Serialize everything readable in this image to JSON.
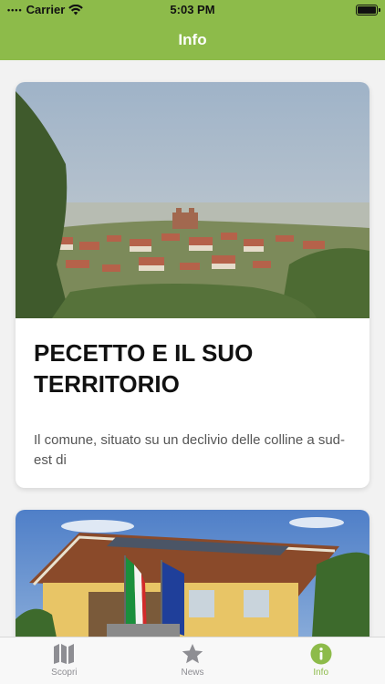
{
  "status_bar": {
    "carrier": "Carrier",
    "time": "5:03 PM"
  },
  "nav": {
    "title": "Info"
  },
  "cards": [
    {
      "title": "PECETTO E IL SUO TERRITORIO",
      "description": "Il comune, situato su un declivio delle colline a sud-est di"
    }
  ],
  "tabs": [
    {
      "label": "Scopri",
      "icon": "map-icon",
      "active": false
    },
    {
      "label": "News",
      "icon": "star-icon",
      "active": false
    },
    {
      "label": "Info",
      "icon": "info-icon",
      "active": true
    }
  ],
  "colors": {
    "accent": "#8dbb4a",
    "inactive": "#8e8e93"
  }
}
